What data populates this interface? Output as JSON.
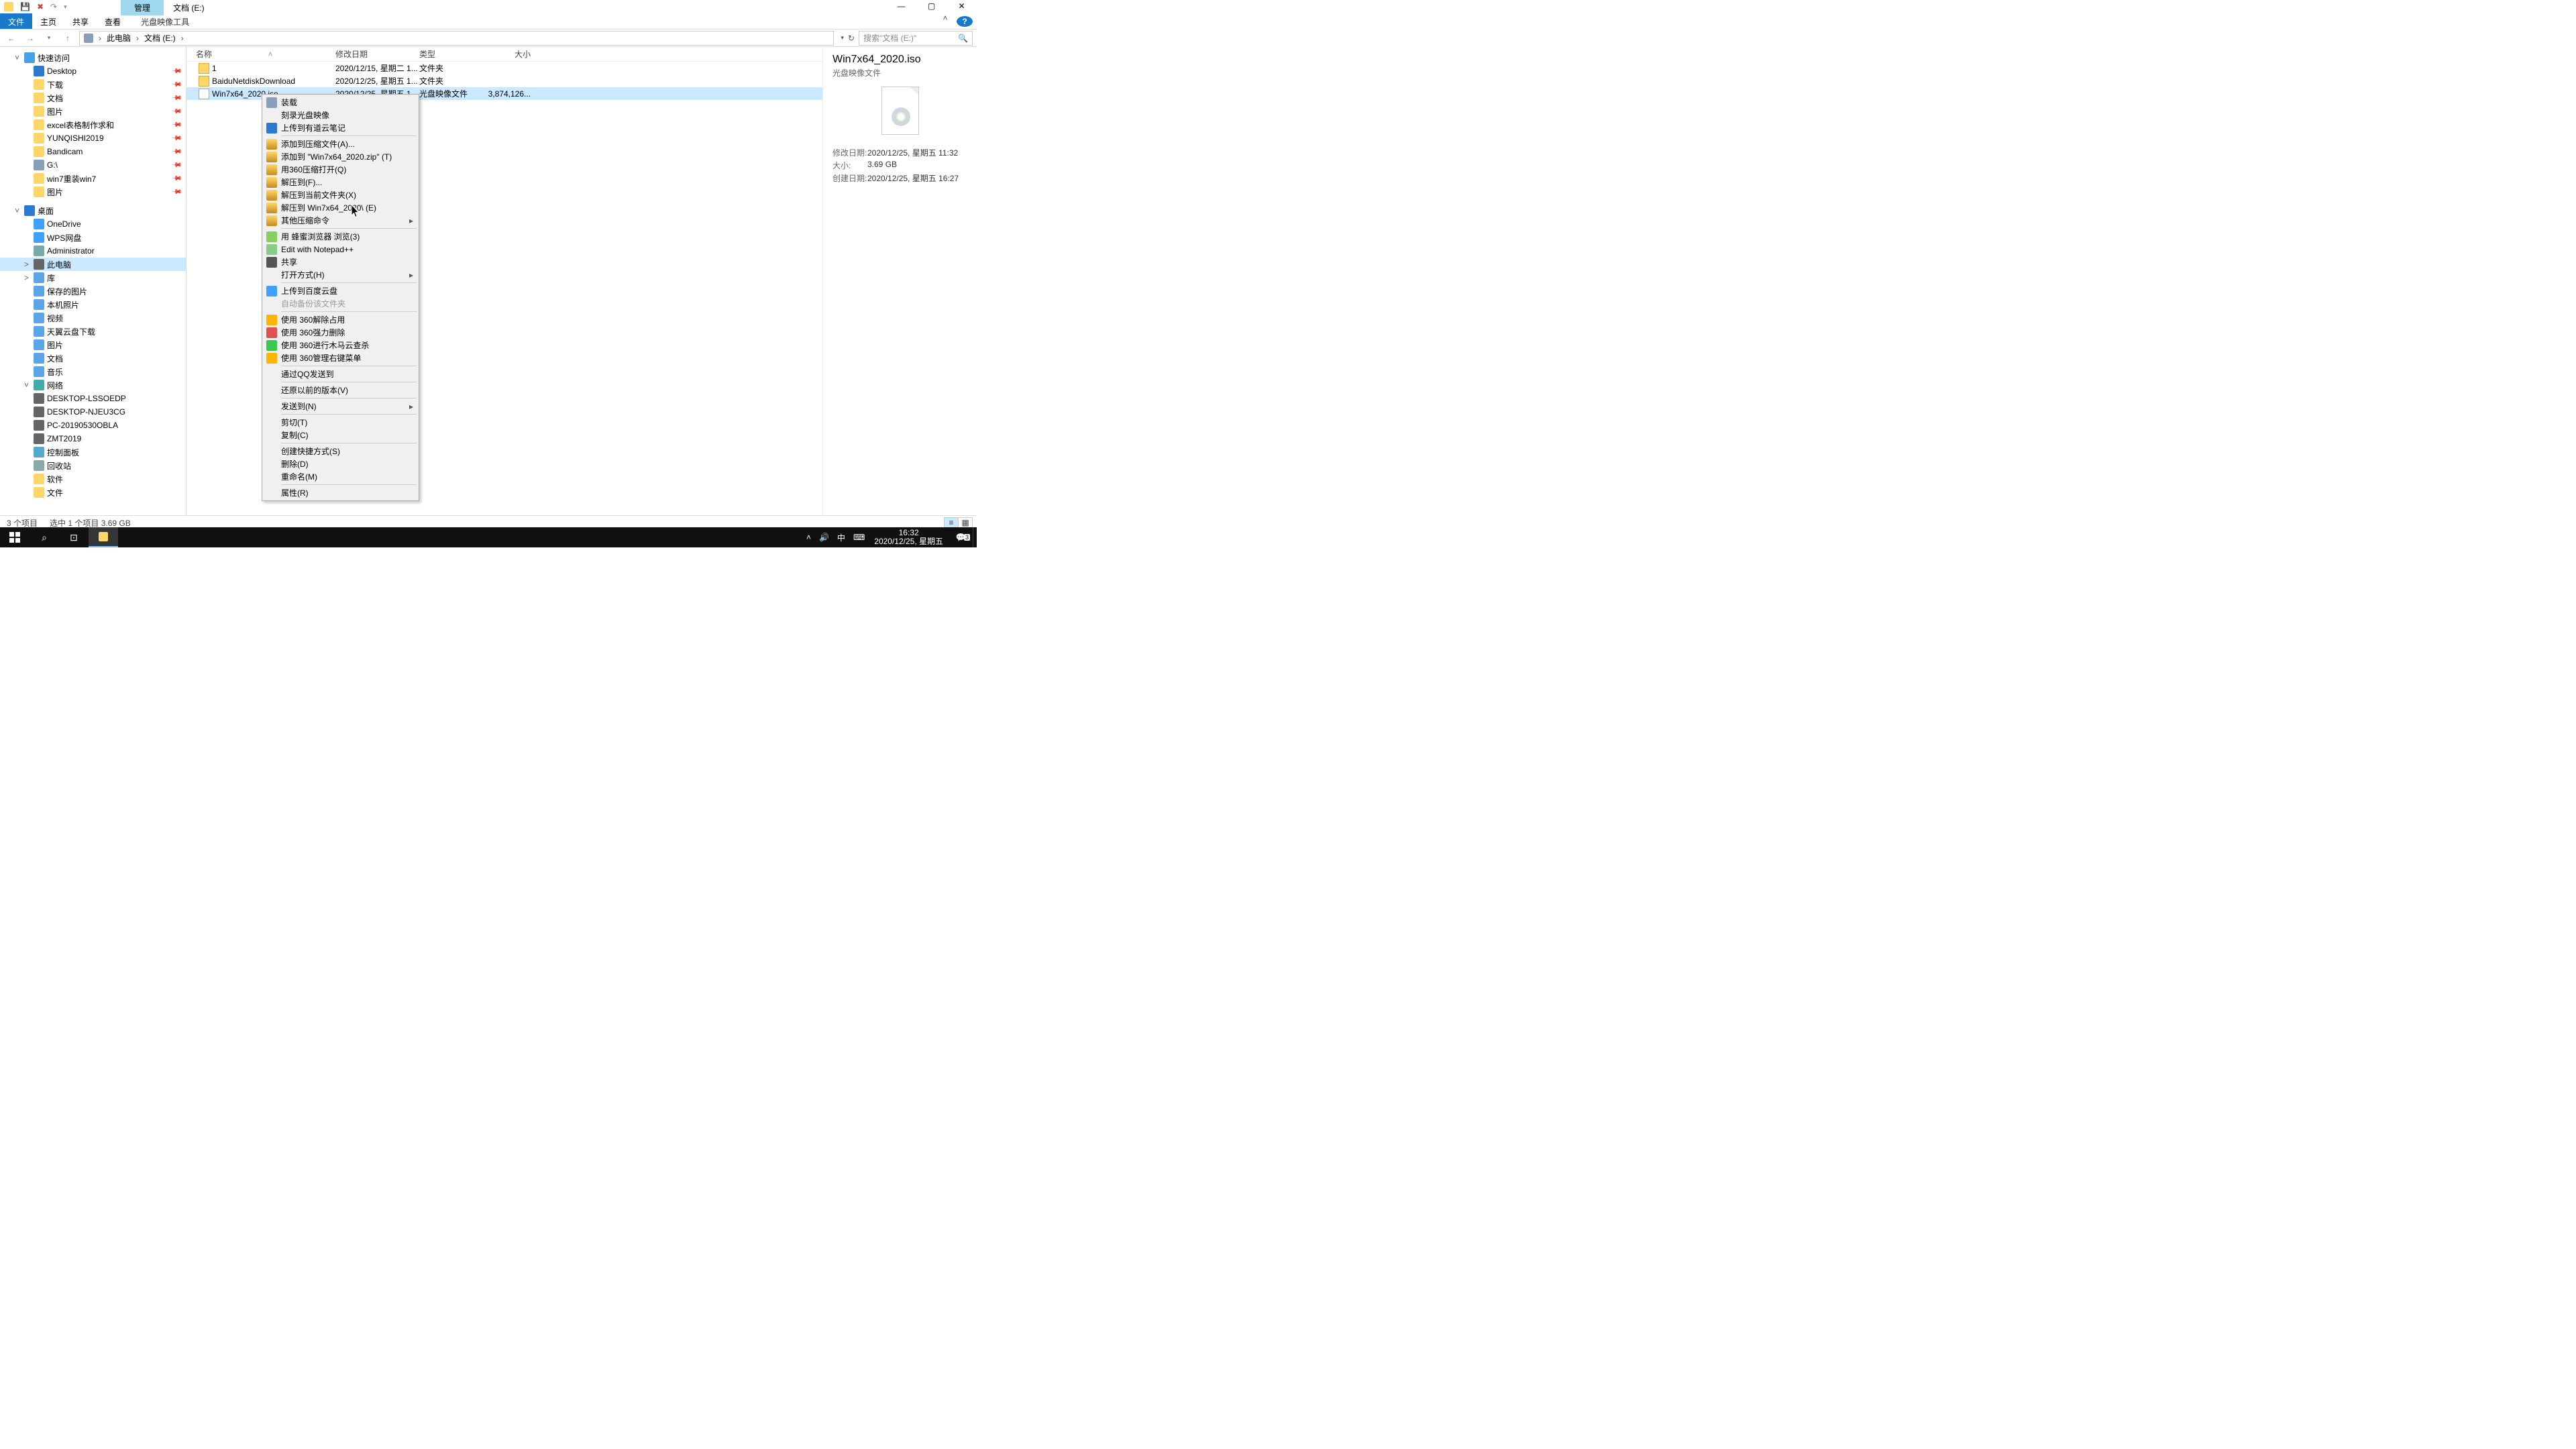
{
  "window": {
    "ctx_tab": "管理",
    "title_tab": "文档 (E:)"
  },
  "ribbon": {
    "file": "文件",
    "home": "主页",
    "share": "共享",
    "view": "查看",
    "tool": "光盘映像工具"
  },
  "breadcrumb": {
    "root": "此电脑",
    "path1": "文档 (E:)"
  },
  "search": {
    "placeholder": "搜索\"文档 (E:)\""
  },
  "tree": {
    "quick": "快速访问",
    "pins": [
      "Desktop",
      "下载",
      "文档",
      "图片",
      "excel表格制作求和",
      "YUNQISHI2019",
      "Bandicam",
      "G:\\",
      "win7重装win7",
      "图片"
    ],
    "desktop": "桌面",
    "desktop_items": [
      "OneDrive",
      "WPS网盘",
      "Administrator",
      "此电脑",
      "库"
    ],
    "lib_items": [
      "保存的图片",
      "本机照片",
      "视频",
      "天翼云盘下载",
      "图片",
      "文档",
      "音乐"
    ],
    "network": "网络",
    "net_items": [
      "DESKTOP-LSSOEDP",
      "DESKTOP-NJEU3CG",
      "PC-20190530OBLA",
      "ZMT2019"
    ],
    "others": [
      "控制面板",
      "回收站",
      "软件",
      "文件"
    ]
  },
  "cols": {
    "name": "名称",
    "date": "修改日期",
    "type": "类型",
    "size": "大小"
  },
  "rows": [
    {
      "name": "1",
      "date": "2020/12/15, 星期二 1...",
      "type": "文件夹",
      "size": ""
    },
    {
      "name": "BaiduNetdiskDownload",
      "date": "2020/12/25, 星期五 1...",
      "type": "文件夹",
      "size": ""
    },
    {
      "name": "Win7x64_2020.iso",
      "date": "2020/12/25, 星期五 1...",
      "type": "光盘映像文件",
      "size": "3,874,126..."
    }
  ],
  "ctx": [
    "装载",
    "刻录光盘映像",
    "上传到有道云笔记",
    "---",
    "添加到压缩文件(A)...",
    "添加到 \"Win7x64_2020.zip\" (T)",
    "用360压缩打开(Q)",
    "解压到(F)...",
    "解压到当前文件夹(X)",
    "解压到 Win7x64_2020\\ (E)",
    "其他压缩命令",
    "---",
    "用 蜂蜜浏览器 浏览(3)",
    "Edit with Notepad++",
    "共享",
    "打开方式(H)",
    "---",
    "上传到百度云盘",
    "自动备份该文件夹",
    "---",
    "使用 360解除占用",
    "使用 360强力删除",
    "使用 360进行木马云查杀",
    "使用 360管理右键菜单",
    "---",
    "通过QQ发送到",
    "---",
    "还原以前的版本(V)",
    "---",
    "发送到(N)",
    "---",
    "剪切(T)",
    "复制(C)",
    "---",
    "创建快捷方式(S)",
    "删除(D)",
    "重命名(M)",
    "---",
    "属性(R)"
  ],
  "ctx_submenu": [
    "其他压缩命令",
    "打开方式(H)",
    "发送到(N)"
  ],
  "ctx_disabled": [
    "自动备份该文件夹"
  ],
  "details": {
    "title": "Win7x64_2020.iso",
    "subtitle": "光盘映像文件",
    "props": [
      {
        "k": "修改日期:",
        "v": "2020/12/25, 星期五 11:32"
      },
      {
        "k": "大小:",
        "v": "3.69 GB"
      },
      {
        "k": "创建日期:",
        "v": "2020/12/25, 星期五 16:27"
      }
    ]
  },
  "status": {
    "count": "3 个项目",
    "sel": "选中 1 个项目  3.69 GB"
  },
  "taskbar": {
    "ime": "中",
    "time": "16:32",
    "date": "2020/12/25, 星期五",
    "notif_count": "3"
  }
}
